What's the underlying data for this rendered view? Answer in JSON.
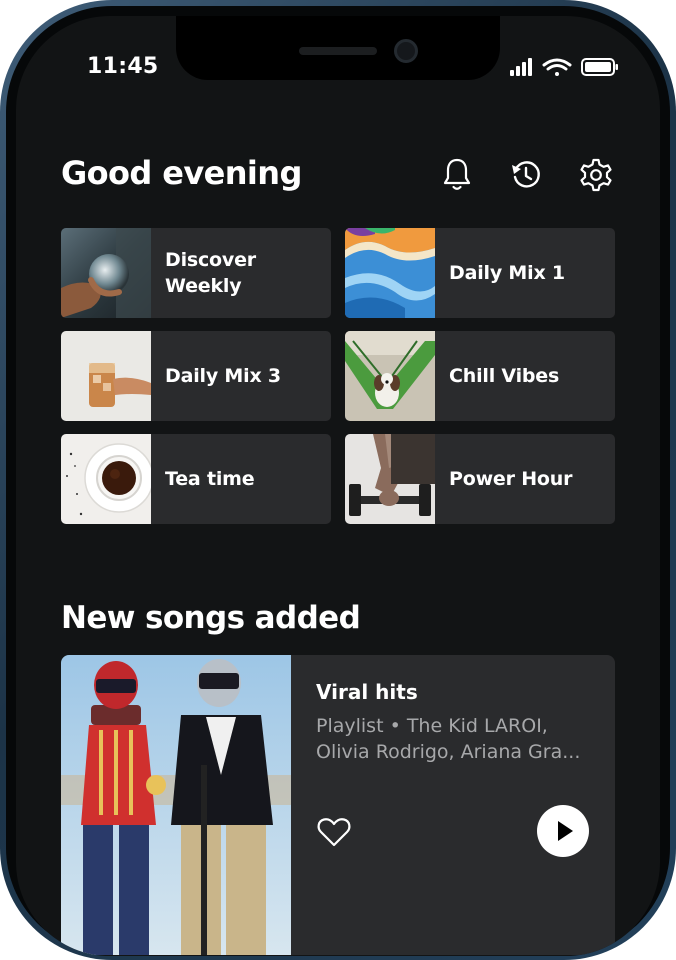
{
  "status_bar": {
    "time": "11:45"
  },
  "header": {
    "greeting": "Good evening",
    "icons": [
      "bell-icon",
      "history-icon",
      "gear-icon"
    ]
  },
  "shortcuts": [
    {
      "label": "Discover\nWeekly",
      "thumb": "crystal-ball-art"
    },
    {
      "label": "Daily Mix 1",
      "thumb": "marble-art"
    },
    {
      "label": "Daily Mix 3",
      "thumb": "iced-tea-art"
    },
    {
      "label": "Chill Vibes",
      "thumb": "dog-hammock-art"
    },
    {
      "label": "Tea time",
      "thumb": "tea-cup-art"
    },
    {
      "label": "Power Hour",
      "thumb": "dumbbell-art"
    }
  ],
  "new_songs": {
    "title": "New songs added",
    "card": {
      "title": "Viral hits",
      "subtitle": "Playlist • The Kid LAROI, Olivia Rodrigo, Ariana Gra...",
      "art": "helmets-duo-art",
      "actions": [
        "heart-icon",
        "play-icon"
      ]
    }
  },
  "colors": {
    "background": "#121415",
    "card": "#2a2b2d",
    "text": "#ffffff",
    "muted_text": "#a7a8aa",
    "frame": "#1c3347"
  }
}
